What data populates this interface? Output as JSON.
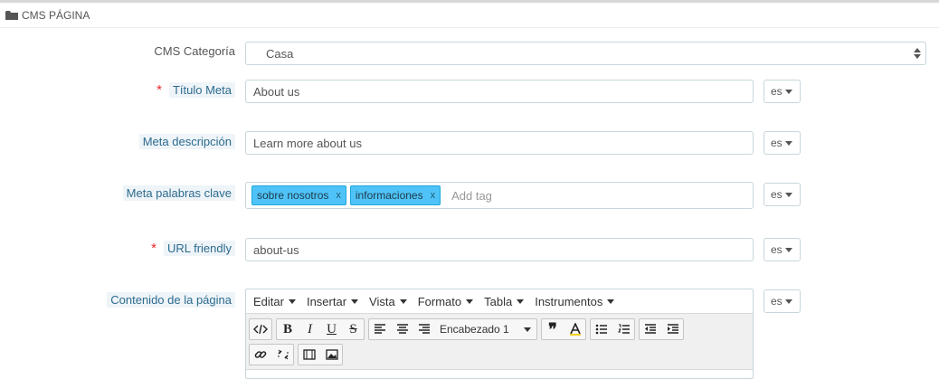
{
  "panel": {
    "title": "CMS PÁGINA",
    "icon": "folder-icon"
  },
  "category": {
    "label": "CMS Categoría",
    "value": "Casa"
  },
  "meta_title": {
    "label": "Título Meta",
    "required": "*",
    "value": "About us",
    "lang": "es"
  },
  "meta_description": {
    "label": "Meta descripción",
    "value": "Learn more about us",
    "lang": "es"
  },
  "meta_keywords": {
    "label": "Meta palabras clave",
    "tags": [
      {
        "text": "sobre nosotros",
        "remove": "x"
      },
      {
        "text": "informaciones",
        "remove": "x"
      }
    ],
    "placeholder": "Add tag",
    "lang": "es"
  },
  "url_friendly": {
    "label": "URL friendly",
    "required": "*",
    "value": "about-us",
    "lang": "es"
  },
  "content": {
    "label": "Contenido de la página",
    "lang": "es",
    "menubar": [
      "Editar",
      "Insertar",
      "Vista",
      "Formato",
      "Tabla",
      "Instrumentos"
    ],
    "format_select": "Encabezado 1"
  },
  "colors": {
    "tag_bg": "#4fc3f7",
    "required": "#e52b2b",
    "label_hint_bg": "#eef4f8"
  }
}
